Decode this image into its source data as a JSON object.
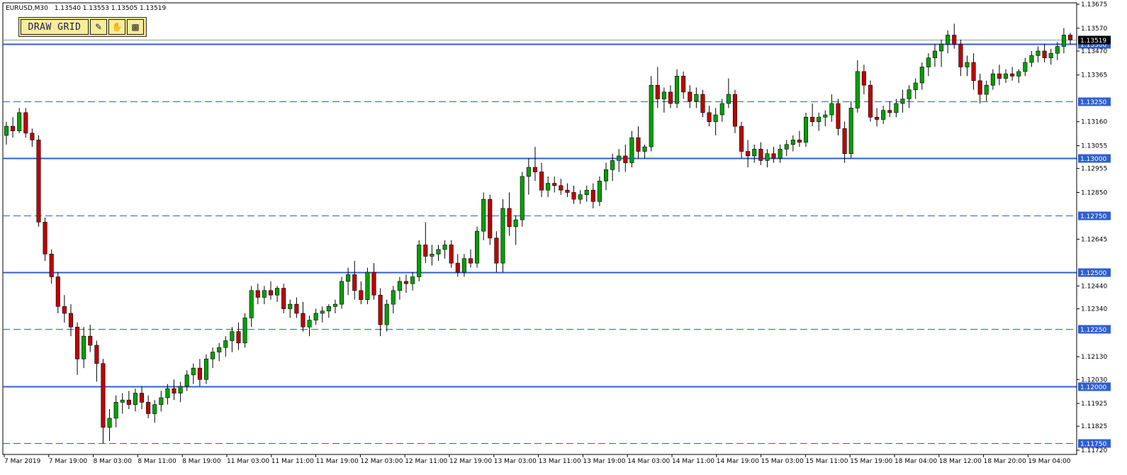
{
  "header": {
    "symbol": "EURUSD,M30",
    "ohlc": "1.13540 1.13553 1.13505 1.13519"
  },
  "toolbar": {
    "draw_grid_label": "DRAW GRID",
    "icons": [
      "pen-icon",
      "hand-icon",
      "monitor-icon"
    ]
  },
  "colors": {
    "bull_body": "#00a000",
    "bear_body": "#c00000",
    "wick": "#000000",
    "level_line": "#2f5fd0",
    "tag_bg": "#2f5fd0",
    "current_price_tag": "#000000"
  },
  "chart_data": {
    "type": "candlestick",
    "title": "",
    "ylim": [
      1.1172,
      1.13675
    ],
    "price_ticks": [
      "1.13675",
      "1.13570",
      "1.13470",
      "1.13365",
      "1.13260",
      "1.13160",
      "1.13055",
      "1.12955",
      "1.12850",
      "1.12645",
      "1.12440",
      "1.12340",
      "1.12235",
      "1.12130",
      "1.12030",
      "1.11925",
      "1.11825",
      "1.11720"
    ],
    "levels": [
      {
        "price": 1.135,
        "label": "1.13500",
        "style": "solid"
      },
      {
        "price": 1.1325,
        "label": "1.13250",
        "style": "dashed"
      },
      {
        "price": 1.13,
        "label": "1.13000",
        "style": "solid"
      },
      {
        "price": 1.1275,
        "label": "1.12750",
        "style": "dashed"
      },
      {
        "price": 1.125,
        "label": "1.12500",
        "style": "solid"
      },
      {
        "price": 1.1225,
        "label": "1.12250",
        "style": "dashed"
      },
      {
        "price": 1.12,
        "label": "1.12000",
        "style": "solid"
      },
      {
        "price": 1.1175,
        "label": "1.11750",
        "style": "dashed"
      }
    ],
    "current_price": {
      "price": 1.13519,
      "label": "1.13519"
    },
    "time_labels": [
      "7 Mar 2019",
      "7 Mar 19:00",
      "8 Mar 03:00",
      "8 Mar 11:00",
      "8 Mar 19:00",
      "11 Mar 03:00",
      "11 Mar 11:00",
      "11 Mar 19:00",
      "12 Mar 03:00",
      "12 Mar 11:00",
      "12 Mar 19:00",
      "13 Mar 03:00",
      "13 Mar 11:00",
      "13 Mar 19:00",
      "14 Mar 03:00",
      "14 Mar 11:00",
      "14 Mar 19:00",
      "15 Mar 03:00",
      "15 Mar 11:00",
      "15 Mar 19:00",
      "18 Mar 04:00",
      "18 Mar 12:00",
      "18 Mar 20:00",
      "19 Mar 04:00"
    ],
    "candles": [
      [
        1.131,
        1.1316,
        1.1306,
        1.1314
      ],
      [
        1.1314,
        1.1318,
        1.1309,
        1.1312
      ],
      [
        1.1312,
        1.1322,
        1.1311,
        1.132
      ],
      [
        1.132,
        1.1322,
        1.1309,
        1.1311
      ],
      [
        1.1311,
        1.1313,
        1.1305,
        1.1308
      ],
      [
        1.1308,
        1.131,
        1.127,
        1.1272
      ],
      [
        1.1272,
        1.1274,
        1.1255,
        1.1258
      ],
      [
        1.1258,
        1.126,
        1.1245,
        1.1248
      ],
      [
        1.1248,
        1.125,
        1.1232,
        1.1235
      ],
      [
        1.1235,
        1.124,
        1.1228,
        1.1232
      ],
      [
        1.1232,
        1.1236,
        1.1222,
        1.1226
      ],
      [
        1.1226,
        1.1228,
        1.1205,
        1.1212
      ],
      [
        1.1212,
        1.1226,
        1.1208,
        1.1222
      ],
      [
        1.1222,
        1.1227,
        1.1215,
        1.1218
      ],
      [
        1.1218,
        1.122,
        1.1202,
        1.121
      ],
      [
        1.121,
        1.1212,
        1.1175,
        1.1182
      ],
      [
        1.1182,
        1.119,
        1.1176,
        1.1186
      ],
      [
        1.1186,
        1.1196,
        1.1182,
        1.1193
      ],
      [
        1.1193,
        1.1197,
        1.1188,
        1.1194
      ],
      [
        1.1194,
        1.1198,
        1.119,
        1.1192
      ],
      [
        1.1192,
        1.1199,
        1.1189,
        1.1197
      ],
      [
        1.1197,
        1.12,
        1.119,
        1.1193
      ],
      [
        1.1193,
        1.1196,
        1.1186,
        1.1188
      ],
      [
        1.1188,
        1.1194,
        1.1184,
        1.1192
      ],
      [
        1.1192,
        1.1198,
        1.1189,
        1.1195
      ],
      [
        1.1195,
        1.1201,
        1.1192,
        1.1199
      ],
      [
        1.1199,
        1.1203,
        1.1194,
        1.1197
      ],
      [
        1.1197,
        1.1202,
        1.1193,
        1.12
      ],
      [
        1.12,
        1.1207,
        1.1198,
        1.1205
      ],
      [
        1.1205,
        1.121,
        1.1201,
        1.1208
      ],
      [
        1.1208,
        1.1212,
        1.12,
        1.1203
      ],
      [
        1.1203,
        1.1214,
        1.1201,
        1.1212
      ],
      [
        1.1212,
        1.1217,
        1.1208,
        1.1215
      ],
      [
        1.1215,
        1.1219,
        1.1211,
        1.1217
      ],
      [
        1.1217,
        1.1222,
        1.1213,
        1.122
      ],
      [
        1.122,
        1.1226,
        1.1215,
        1.1224
      ],
      [
        1.1224,
        1.1228,
        1.1216,
        1.1219
      ],
      [
        1.1219,
        1.1232,
        1.1217,
        1.123
      ],
      [
        1.123,
        1.1244,
        1.1226,
        1.1242
      ],
      [
        1.1242,
        1.1245,
        1.1236,
        1.1239
      ],
      [
        1.1239,
        1.1244,
        1.1236,
        1.1242
      ],
      [
        1.1242,
        1.1246,
        1.1238,
        1.124
      ],
      [
        1.124,
        1.1244,
        1.1237,
        1.1243
      ],
      [
        1.1243,
        1.1245,
        1.1232,
        1.1234
      ],
      [
        1.1234,
        1.1238,
        1.123,
        1.1236
      ],
      [
        1.1236,
        1.1239,
        1.123,
        1.1232
      ],
      [
        1.1232,
        1.1237,
        1.1224,
        1.1226
      ],
      [
        1.1226,
        1.1231,
        1.1222,
        1.1229
      ],
      [
        1.1229,
        1.1234,
        1.1227,
        1.1232
      ],
      [
        1.1232,
        1.1235,
        1.1228,
        1.1233
      ],
      [
        1.1233,
        1.1236,
        1.123,
        1.1235
      ],
      [
        1.1235,
        1.1238,
        1.1232,
        1.1236
      ],
      [
        1.1236,
        1.1248,
        1.1234,
        1.1246
      ],
      [
        1.1246,
        1.1252,
        1.124,
        1.1249
      ],
      [
        1.1249,
        1.1255,
        1.1238,
        1.1242
      ],
      [
        1.1242,
        1.1246,
        1.1236,
        1.1238
      ],
      [
        1.1238,
        1.1252,
        1.1236,
        1.125
      ],
      [
        1.125,
        1.1254,
        1.1238,
        1.124
      ],
      [
        1.124,
        1.1243,
        1.1222,
        1.1227
      ],
      [
        1.1227,
        1.1238,
        1.1224,
        1.1236
      ],
      [
        1.1236,
        1.1244,
        1.1232,
        1.1242
      ],
      [
        1.1242,
        1.1248,
        1.1238,
        1.1246
      ],
      [
        1.1246,
        1.1249,
        1.1241,
        1.1245
      ],
      [
        1.1245,
        1.125,
        1.1242,
        1.1248
      ],
      [
        1.1248,
        1.1264,
        1.1246,
        1.1262
      ],
      [
        1.1262,
        1.1272,
        1.1254,
        1.1257
      ],
      [
        1.1257,
        1.1262,
        1.1253,
        1.1258
      ],
      [
        1.1258,
        1.1262,
        1.1255,
        1.126
      ],
      [
        1.126,
        1.1264,
        1.1256,
        1.1262
      ],
      [
        1.1262,
        1.1264,
        1.1252,
        1.1254
      ],
      [
        1.1254,
        1.1258,
        1.1248,
        1.125
      ],
      [
        1.125,
        1.1258,
        1.1248,
        1.1256
      ],
      [
        1.1256,
        1.126,
        1.1252,
        1.1254
      ],
      [
        1.1254,
        1.127,
        1.1252,
        1.1268
      ],
      [
        1.1268,
        1.1285,
        1.1264,
        1.1282
      ],
      [
        1.1282,
        1.1284,
        1.1262,
        1.1265
      ],
      [
        1.1265,
        1.1268,
        1.125,
        1.1254
      ],
      [
        1.1254,
        1.1282,
        1.125,
        1.1278
      ],
      [
        1.1278,
        1.1285,
        1.1266,
        1.127
      ],
      [
        1.127,
        1.1275,
        1.1262,
        1.1273
      ],
      [
        1.1273,
        1.1294,
        1.127,
        1.1292
      ],
      [
        1.1292,
        1.13,
        1.1284,
        1.1296
      ],
      [
        1.1296,
        1.1305,
        1.129,
        1.1294
      ],
      [
        1.1294,
        1.1298,
        1.1283,
        1.1286
      ],
      [
        1.1286,
        1.1292,
        1.1283,
        1.1289
      ],
      [
        1.1289,
        1.1292,
        1.1285,
        1.1288
      ],
      [
        1.1288,
        1.1291,
        1.1284,
        1.1286
      ],
      [
        1.1286,
        1.1289,
        1.1283,
        1.1285
      ],
      [
        1.1285,
        1.1288,
        1.128,
        1.1282
      ],
      [
        1.1282,
        1.1286,
        1.128,
        1.1284
      ],
      [
        1.1284,
        1.1288,
        1.1281,
        1.1286
      ],
      [
        1.1286,
        1.1289,
        1.1278,
        1.1281
      ],
      [
        1.1281,
        1.1292,
        1.1279,
        1.129
      ],
      [
        1.129,
        1.1298,
        1.1286,
        1.1295
      ],
      [
        1.1295,
        1.1302,
        1.129,
        1.1299
      ],
      [
        1.1299,
        1.1304,
        1.1294,
        1.1301
      ],
      [
        1.1301,
        1.1306,
        1.1294,
        1.1298
      ],
      [
        1.1298,
        1.1312,
        1.1296,
        1.1309
      ],
      [
        1.1309,
        1.1314,
        1.13,
        1.1303
      ],
      [
        1.1303,
        1.1306,
        1.13,
        1.1305
      ],
      [
        1.1305,
        1.1336,
        1.1303,
        1.1332
      ],
      [
        1.1332,
        1.134,
        1.1322,
        1.1326
      ],
      [
        1.1326,
        1.1331,
        1.132,
        1.1329
      ],
      [
        1.1329,
        1.1332,
        1.1322,
        1.1324
      ],
      [
        1.1324,
        1.1339,
        1.1322,
        1.1336
      ],
      [
        1.1336,
        1.1338,
        1.1326,
        1.1329
      ],
      [
        1.1329,
        1.1332,
        1.1322,
        1.1325
      ],
      [
        1.1325,
        1.1331,
        1.1322,
        1.1328
      ],
      [
        1.1328,
        1.133,
        1.1318,
        1.132
      ],
      [
        1.132,
        1.1323,
        1.1314,
        1.1316
      ],
      [
        1.1316,
        1.1322,
        1.131,
        1.1319
      ],
      [
        1.1319,
        1.1326,
        1.1316,
        1.1324
      ],
      [
        1.1324,
        1.1335,
        1.1322,
        1.1328
      ],
      [
        1.1328,
        1.133,
        1.1311,
        1.1314
      ],
      [
        1.1314,
        1.1316,
        1.13,
        1.1303
      ],
      [
        1.1303,
        1.1308,
        1.1296,
        1.1301
      ],
      [
        1.1301,
        1.1306,
        1.1298,
        1.1304
      ],
      [
        1.1304,
        1.1307,
        1.1297,
        1.1299
      ],
      [
        1.1299,
        1.1304,
        1.1296,
        1.1302
      ],
      [
        1.1302,
        1.1305,
        1.1298,
        1.13
      ],
      [
        1.13,
        1.1306,
        1.1298,
        1.1304
      ],
      [
        1.1304,
        1.1308,
        1.1301,
        1.1306
      ],
      [
        1.1306,
        1.131,
        1.1303,
        1.1308
      ],
      [
        1.1308,
        1.1312,
        1.1305,
        1.1307
      ],
      [
        1.1307,
        1.132,
        1.1305,
        1.1318
      ],
      [
        1.1318,
        1.1324,
        1.1314,
        1.1316
      ],
      [
        1.1316,
        1.132,
        1.1312,
        1.1318
      ],
      [
        1.1318,
        1.1321,
        1.1314,
        1.1319
      ],
      [
        1.1319,
        1.1328,
        1.1316,
        1.1324
      ],
      [
        1.1324,
        1.1326,
        1.131,
        1.1313
      ],
      [
        1.1313,
        1.1316,
        1.1298,
        1.1302
      ],
      [
        1.1302,
        1.1325,
        1.13,
        1.1322
      ],
      [
        1.1322,
        1.1343,
        1.132,
        1.1338
      ],
      [
        1.1338,
        1.1341,
        1.1328,
        1.1332
      ],
      [
        1.1332,
        1.1334,
        1.1316,
        1.1318
      ],
      [
        1.1318,
        1.1322,
        1.1314,
        1.1317
      ],
      [
        1.1317,
        1.1323,
        1.1315,
        1.1321
      ],
      [
        1.1321,
        1.1325,
        1.1318,
        1.132
      ],
      [
        1.132,
        1.1326,
        1.1318,
        1.1324
      ],
      [
        1.1324,
        1.133,
        1.132,
        1.1326
      ],
      [
        1.1326,
        1.1332,
        1.1322,
        1.133
      ],
      [
        1.133,
        1.1335,
        1.1326,
        1.1333
      ],
      [
        1.1333,
        1.1342,
        1.133,
        1.134
      ],
      [
        1.134,
        1.1346,
        1.1336,
        1.1344
      ],
      [
        1.1344,
        1.135,
        1.134,
        1.1347
      ],
      [
        1.1347,
        1.1352,
        1.134,
        1.135
      ],
      [
        1.135,
        1.1356,
        1.1346,
        1.1354
      ],
      [
        1.1354,
        1.1359,
        1.1348,
        1.135
      ],
      [
        1.135,
        1.1352,
        1.1336,
        1.134
      ],
      [
        1.134,
        1.1345,
        1.1336,
        1.1342
      ],
      [
        1.1342,
        1.1346,
        1.133,
        1.1334
      ],
      [
        1.1334,
        1.1337,
        1.1324,
        1.1328
      ],
      [
        1.1328,
        1.1334,
        1.1325,
        1.1332
      ],
      [
        1.1332,
        1.1339,
        1.133,
        1.1337
      ],
      [
        1.1337,
        1.1341,
        1.1332,
        1.1335
      ],
      [
        1.1335,
        1.1339,
        1.1333,
        1.1337
      ],
      [
        1.1337,
        1.134,
        1.1334,
        1.1336
      ],
      [
        1.1336,
        1.1339,
        1.1333,
        1.1338
      ],
      [
        1.1338,
        1.1344,
        1.1336,
        1.1342
      ],
      [
        1.1342,
        1.1347,
        1.134,
        1.1345
      ],
      [
        1.1345,
        1.1349,
        1.1342,
        1.1347
      ],
      [
        1.1347,
        1.135,
        1.1342,
        1.1344
      ],
      [
        1.1344,
        1.1348,
        1.1341,
        1.1346
      ],
      [
        1.1346,
        1.1351,
        1.1343,
        1.1349
      ],
      [
        1.1349,
        1.1357,
        1.1346,
        1.1354
      ],
      [
        1.1354,
        1.1355,
        1.135,
        1.13519
      ]
    ]
  }
}
